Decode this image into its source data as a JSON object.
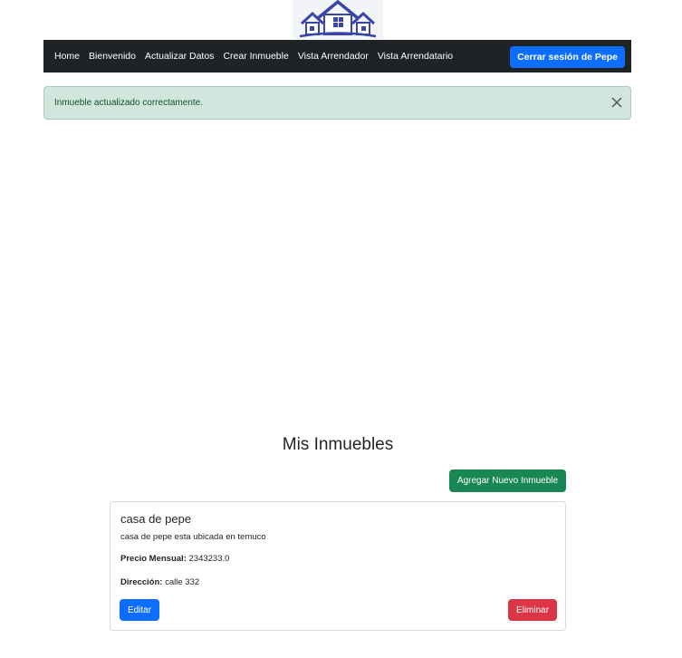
{
  "logo": {
    "icon": "houses-logo-icon",
    "color": "#3a45a8"
  },
  "navbar": {
    "links": [
      "Home",
      "Bienvenido",
      "Actualizar Datos",
      "Crear Inmueble",
      "Vista Arrendador",
      "Vista Arrendatario"
    ],
    "logout_label": "Cerrar sesión de Pepe"
  },
  "alert": {
    "message": "Inmueble actualizado correctamente.",
    "close_icon": "close-icon"
  },
  "main": {
    "title": "Mis Inmuebles",
    "add_button": "Agregar Nuevo Inmueble"
  },
  "properties": [
    {
      "name": "casa de pepe",
      "description": "casa de pepe esta ubicada en temuco",
      "price_label": "Precio Mensual:",
      "price_value": "2343233.0",
      "address_label": "Dirección:",
      "address_value": "calle 332",
      "edit_label": "Editar",
      "delete_label": "Eliminar"
    }
  ],
  "colors": {
    "navbar_bg": "#1f2326",
    "primary": "#0d6efd",
    "success": "#198754",
    "danger": "#dc3545",
    "alert_bg": "#d1e7dd"
  }
}
